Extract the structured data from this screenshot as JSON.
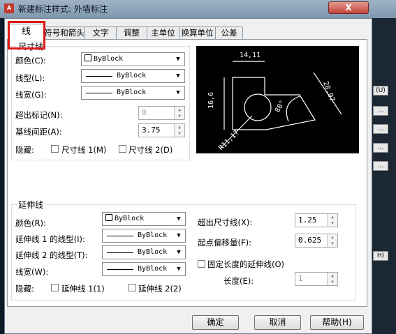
{
  "window": {
    "title": "新建标注样式: 外墙标注",
    "close_label": "X",
    "app_badge": "A"
  },
  "tabs": [
    "线",
    "符号和箭头",
    "文字",
    "调整",
    "主单位",
    "换算单位",
    "公差"
  ],
  "dimension_lines": {
    "group_title": "尺寸线",
    "color_label": "颜色(C):",
    "color_value": "ByBlock",
    "linetype_label": "线型(L):",
    "linetype_value": "ByBlock",
    "lineweight_label": "线宽(G):",
    "lineweight_value": "ByBlock",
    "extend_ticks_label": "超出标记(N):",
    "extend_ticks_value": "0",
    "baseline_spacing_label": "基线间距(A):",
    "baseline_spacing_value": "3.75",
    "suppress_label": "隐藏:",
    "suppress_dim1_label": "尺寸线 1(M)",
    "suppress_dim2_label": "尺寸线 2(D)"
  },
  "extension_lines": {
    "group_title": "延伸线",
    "color_label": "颜色(R):",
    "color_value": "ByBlock",
    "ext1_linetype_label": "延伸线 1 的线型(I):",
    "ext1_linetype_value": "ByBlock",
    "ext2_linetype_label": "延伸线 2 的线型(T):",
    "ext2_linetype_value": "ByBlock",
    "lineweight_label": "线宽(W):",
    "lineweight_value": "ByBlock",
    "suppress_label": "隐藏:",
    "suppress_ext1_label": "延伸线 1(1)",
    "suppress_ext2_label": "延伸线 2(2)",
    "extend_beyond_label": "超出尺寸线(X):",
    "extend_beyond_value": "1.25",
    "offset_origin_label": "起点偏移量(F):",
    "offset_origin_value": "0.625",
    "fixed_length_label": "固定长度的延伸线(O)",
    "length_label": "长度(E):",
    "length_value": "1"
  },
  "preview": {
    "dim_top": "14,11",
    "dim_left": "16,6",
    "dim_right": "28,07",
    "dim_angle": "80°",
    "dim_radius": "R11,17"
  },
  "buttons": {
    "ok": "确定",
    "cancel": "取消",
    "help": "帮助(H)"
  },
  "background_buttons": [
    "(U)",
    "...",
    "...",
    "...",
    "...",
    "H)"
  ]
}
